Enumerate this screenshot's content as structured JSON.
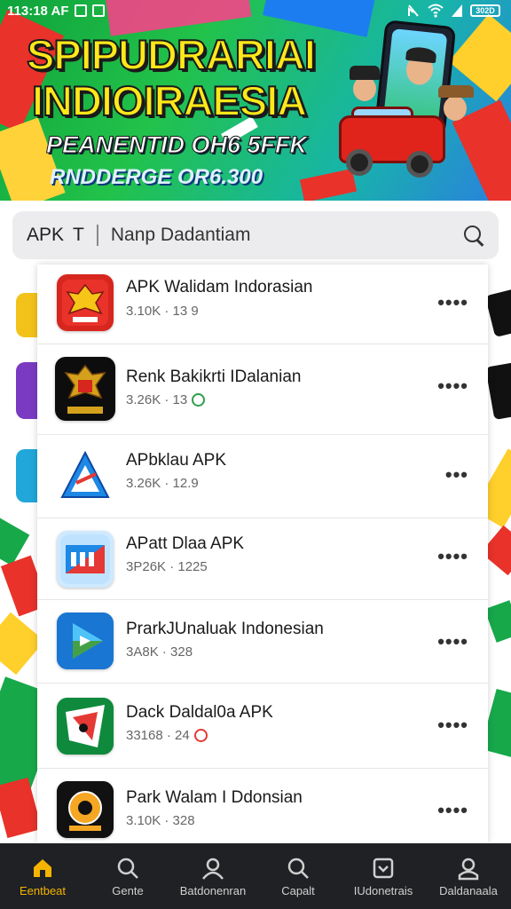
{
  "status_bar": {
    "time": "113:18 AF",
    "battery": "302D"
  },
  "banner": {
    "title_line1": "SPIPUDRARIAI",
    "title_line2": "INDIOIRAESIA",
    "subtitle_line1": "PEANENTID OH6 5FFK",
    "subtitle_line2": "RNDDERGE OR6.300"
  },
  "search": {
    "prefix": "APK",
    "prefix_icon": "T",
    "query": "Nanp Dadantiam"
  },
  "apps": [
    {
      "name": "APK Walidam Indorasian",
      "meta": "3.10K · 13 9",
      "badge": null,
      "more": "••••"
    },
    {
      "name": "Renk Bakikrti IDalanian",
      "meta": "3.26K · 13",
      "badge": "green",
      "more": "••••"
    },
    {
      "name": "APbklau APK",
      "meta": "3.26K · 12.9",
      "badge": null,
      "more": "•••"
    },
    {
      "name": "APatt Dlaa APK",
      "meta": "3P26K · 1225",
      "badge": null,
      "more": "••••"
    },
    {
      "name": "PrarkJUnaluak Indonesian",
      "meta": "3A8K · 328",
      "badge": null,
      "more": "••••"
    },
    {
      "name": "Dack Daldal0a APK",
      "meta": "33168 · 24",
      "badge": "red",
      "more": "••••"
    },
    {
      "name": "Park Walam I Ddonsian",
      "meta": "3.10K · 328",
      "badge": null,
      "more": "••••"
    }
  ],
  "bottom_nav": [
    {
      "label": "Eentbeat",
      "icon": "home-icon",
      "active": true
    },
    {
      "label": "Gente",
      "icon": "search-icon",
      "active": false
    },
    {
      "label": "Batdonenran",
      "icon": "person-icon",
      "active": false
    },
    {
      "label": "Capalt",
      "icon": "search-icon",
      "active": false
    },
    {
      "label": "IUdonetrais",
      "icon": "download-icon",
      "active": false
    },
    {
      "label": "Daldanaala",
      "icon": "profile-icon",
      "active": false
    }
  ],
  "colors": {
    "accent": "#f4b400",
    "nav_bg": "#202124",
    "banner_green": "#22c24a",
    "title_yellow": "#ffe81a"
  }
}
